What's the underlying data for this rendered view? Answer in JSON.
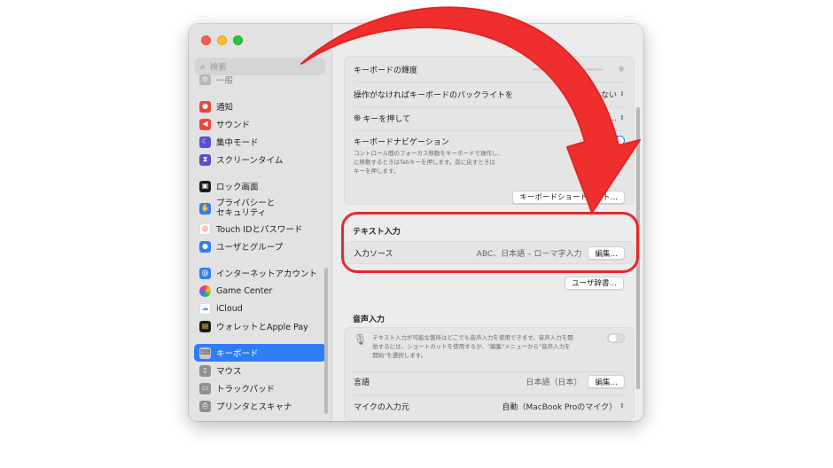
{
  "sidebar": {
    "search_placeholder": "検索",
    "cut_item": "一般",
    "items": [
      {
        "label": "通知",
        "icon": "bell-icon",
        "color": "#f0453a"
      },
      {
        "label": "サウンド",
        "icon": "speaker-icon",
        "color": "#f0453a"
      },
      {
        "label": "集中モード",
        "icon": "moon-icon",
        "color": "#5a4fcf"
      },
      {
        "label": "スクリーンタイム",
        "icon": "hourglass-icon",
        "color": "#5a4fcf"
      },
      {
        "label": "ロック画面",
        "icon": "lock-screen-icon",
        "color": "#1c1c1e"
      },
      {
        "label": "プライバシーと\nセキュリティ",
        "icon": "hand-icon",
        "color": "#2f7df5"
      },
      {
        "label": "Touch IDとパスワード",
        "icon": "fingerprint-icon",
        "color": "#ffffff"
      },
      {
        "label": "ユーザとグループ",
        "icon": "users-icon",
        "color": "#2f7df5"
      },
      {
        "label": "インターネットアカウント",
        "icon": "at-icon",
        "color": "#2f7df5"
      },
      {
        "label": "Game Center",
        "icon": "game-center-icon",
        "color": "#ffffff"
      },
      {
        "label": "iCloud",
        "icon": "cloud-icon",
        "color": "#ffffff"
      },
      {
        "label": "ウォレットとApple Pay",
        "icon": "wallet-icon",
        "color": "#1c1c1e"
      },
      {
        "label": "キーボード",
        "icon": "keyboard-icon",
        "color": "#8e8e93",
        "selected": true
      },
      {
        "label": "マウス",
        "icon": "mouse-icon",
        "color": "#8e8e93"
      },
      {
        "label": "トラックパッド",
        "icon": "trackpad-icon",
        "color": "#8e8e93"
      },
      {
        "label": "プリンタとスキャナ",
        "icon": "printer-icon",
        "color": "#8e8e93"
      }
    ]
  },
  "keyboard": {
    "brightness_label": "キーボードの輝度",
    "backlight_label": "操作がなければキーボードのバックライトを",
    "backlight_value": "しない",
    "globe_label": "キーを押して",
    "globe_value": "…",
    "nav_label": "キーボードナビゲーション",
    "nav_desc": "コントロール間のフォーカス移動をキーボードで操作し、\nに移動するときはTabキーを押します。前に戻すときは\nキーを押します。",
    "shortcuts_button": "キーボードショートカット…"
  },
  "text_input": {
    "section_title": "テキスト入力",
    "source_label": "入力ソース",
    "source_value": "ABC、日本語 – ローマ字入力",
    "edit_button": "編集…",
    "user_dict_button": "ユーザ辞書…"
  },
  "dictation": {
    "section_title": "音声入力",
    "desc": "テキスト入力が可能な箇所はどこでも音声入力を使用できます。音声入力を開\n始するには、ショートカットを使用するか、\"編集\"メニューから\"音声入力を\n開始\"を選択します。",
    "language_label": "言語",
    "language_value": "日本語（日本）",
    "language_edit": "編集…",
    "mic_label": "マイクの入力元",
    "mic_value": "自動（MacBook Proのマイク）"
  },
  "colors": {
    "accent": "#2f7df5",
    "annotation_red": "#e8272a"
  }
}
